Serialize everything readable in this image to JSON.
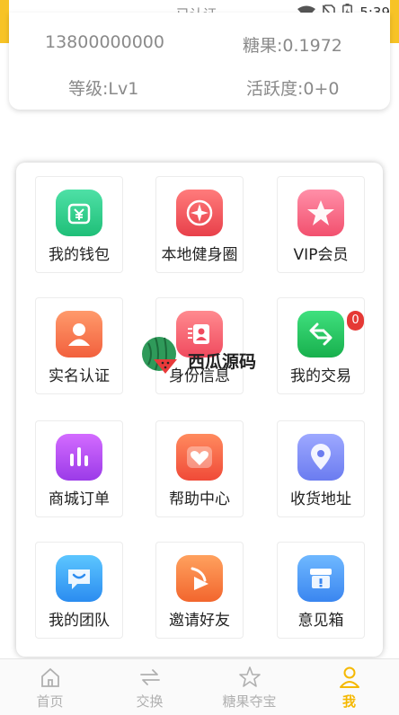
{
  "status_bar": {
    "center_text": "已认证",
    "time": "5:39",
    "icons": [
      "wifi-icon",
      "no-sim-icon",
      "battery-icon"
    ]
  },
  "profile": {
    "phone": "13800000000",
    "candy": "糖果:0.1972",
    "level": "等级:Lv1",
    "activity": "活跃度:0+0"
  },
  "menu": {
    "items": [
      {
        "label": "我的钱包",
        "icon": "wallet-icon",
        "color": "#2ecc8f"
      },
      {
        "label": "本地健身圈",
        "icon": "local-fitness-icon",
        "color": "#f25c5c"
      },
      {
        "label": "VIP会员",
        "icon": "vip-star-icon",
        "color": "#f56a8a"
      },
      {
        "label": "实名认证",
        "icon": "person-verify-icon",
        "color": "#f7784d"
      },
      {
        "label": "身份信息",
        "icon": "id-card-icon",
        "color": "#f56a7e"
      },
      {
        "label": "我的交易",
        "icon": "trade-icon",
        "color": "#27c25e"
      },
      {
        "label": "商城订单",
        "icon": "orders-chart-icon",
        "color": "#b54cf0"
      },
      {
        "label": "帮助中心",
        "icon": "heart-help-icon",
        "color": "#f7603e"
      },
      {
        "label": "收货地址",
        "icon": "location-pin-icon",
        "color": "#7d8df5"
      },
      {
        "label": "我的团队",
        "icon": "team-chat-icon",
        "color": "#3ba8f5"
      },
      {
        "label": "邀请好友",
        "icon": "invite-play-icon",
        "color": "#f57d3a"
      },
      {
        "label": "意见箱",
        "icon": "feedback-box-icon",
        "color": "#4a9cf5"
      }
    ],
    "trade_badge": "0"
  },
  "watermark": {
    "text": "西瓜源码"
  },
  "tabbar": {
    "tabs": [
      {
        "label": "首页",
        "icon": "home-icon"
      },
      {
        "label": "交换",
        "icon": "exchange-icon"
      },
      {
        "label": "糖果夺宝",
        "icon": "star-icon"
      },
      {
        "label": "我",
        "icon": "profile-icon"
      }
    ],
    "active_color": "#f5b800",
    "inactive_color": "#b0b0b0"
  }
}
